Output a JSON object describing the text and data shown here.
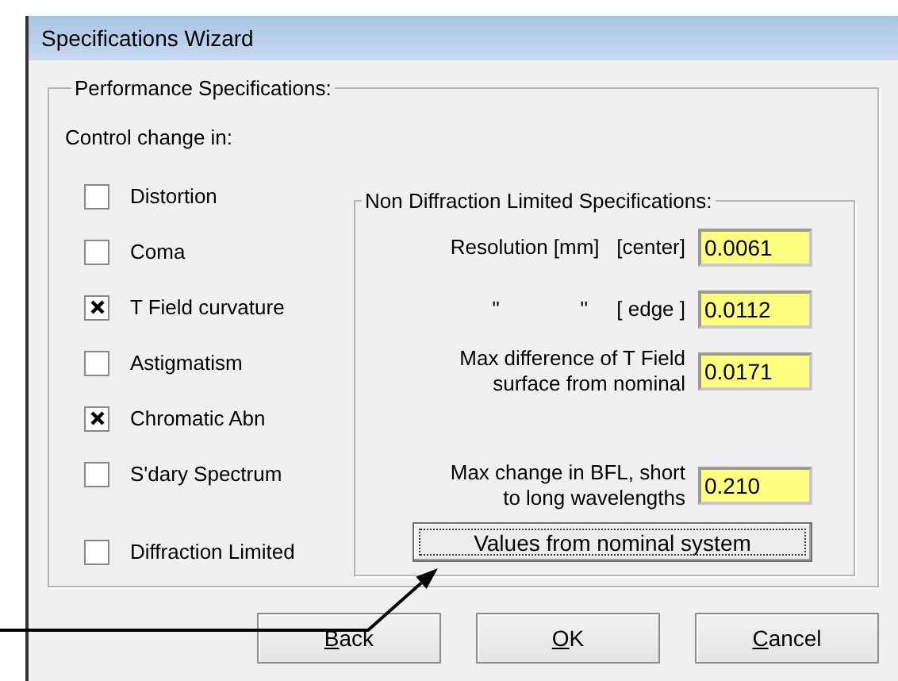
{
  "window": {
    "title": "Specifications Wizard"
  },
  "performance_group": {
    "legend": "Performance Specifications:",
    "control_label": "Control change in:",
    "checkboxes": [
      {
        "label": "Distortion",
        "checked": false
      },
      {
        "label": "Coma",
        "checked": false
      },
      {
        "label": "T Field curvature",
        "checked": true
      },
      {
        "label": "Astigmatism",
        "checked": false
      },
      {
        "label": "Chromatic Abn",
        "checked": true
      },
      {
        "label": "S'dary Spectrum",
        "checked": false
      },
      {
        "label": "Diffraction Limited",
        "checked": false
      }
    ],
    "non_diffraction_group": {
      "legend": "Non Diffraction Limited Specifications:",
      "fields": [
        {
          "label": "Resolution [mm]   [center]",
          "value": "0.0061"
        },
        {
          "label": "''              ''     [ edge ]",
          "value": "0.0112"
        },
        {
          "label": "Max difference of T Field\nsurface from nominal",
          "value": "0.0171"
        },
        {
          "label": "Max change in BFL, short\nto long wavelengths",
          "value": "0.210"
        }
      ],
      "button": "Values from nominal system"
    }
  },
  "buttons": [
    {
      "accel": "B",
      "rest": "ack"
    },
    {
      "accel": "O",
      "rest": "K"
    },
    {
      "accel": "C",
      "rest": "ancel"
    }
  ]
}
